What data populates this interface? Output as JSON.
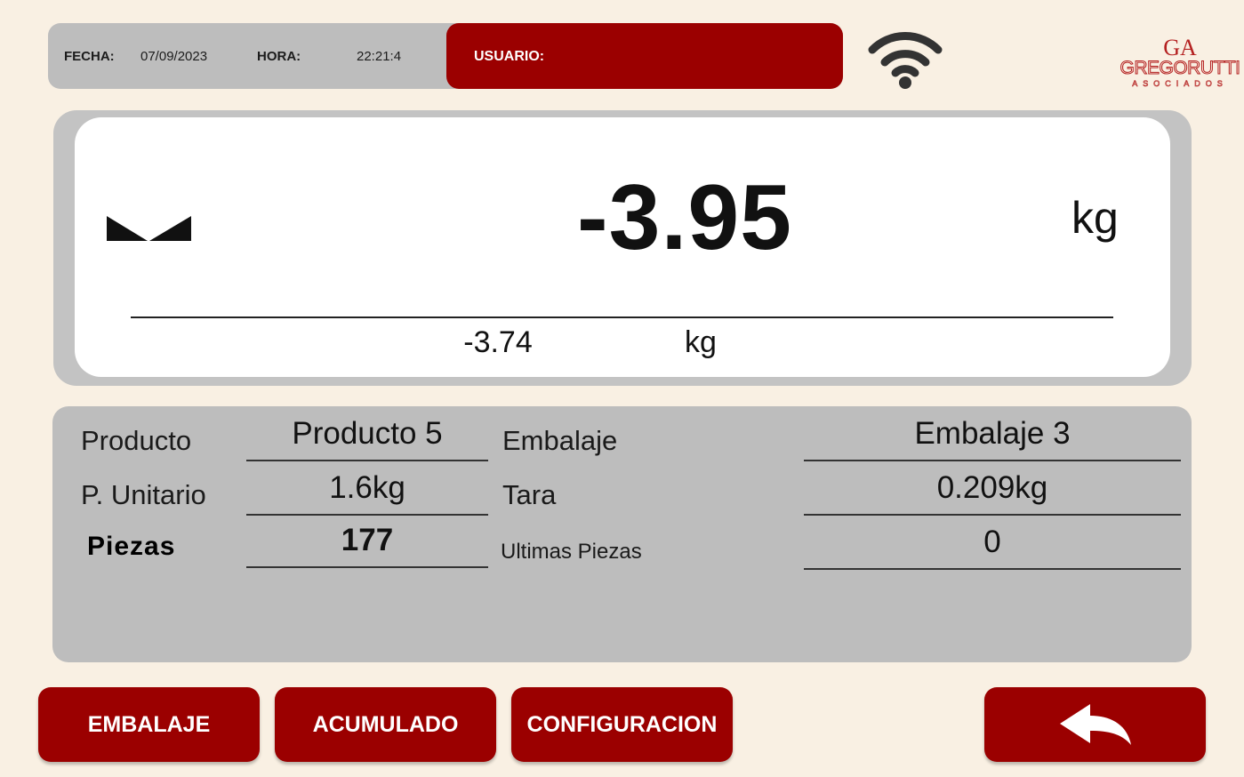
{
  "header": {
    "fecha_label": "FECHA:",
    "fecha_value": "07/09/2023",
    "hora_label": "HORA:",
    "hora_value": "22:21:4",
    "usuario_label": "USUARIO:",
    "usuario_value": ""
  },
  "status": {
    "wifi_icon": "wifi-icon"
  },
  "logo": {
    "name": "GREGORUTTI",
    "sub": "ASOCIADOS",
    "mark": "GA"
  },
  "display": {
    "stability_icon": "unstable-indicator-icon",
    "weight": "-3.95",
    "unit": "kg",
    "secondary_weight": "-3.74",
    "secondary_unit": "kg"
  },
  "info": {
    "producto_label": "Producto",
    "producto_value": "Producto 5",
    "embalaje_label": "Embalaje",
    "embalaje_value": "Embalaje 3",
    "unitario_label": "P. Unitario",
    "unitario_value": "1.6kg",
    "tara_label": "Tara",
    "tara_value": "0.209kg",
    "piezas_label": "Piezas",
    "piezas_value": "177",
    "ultimas_label": "Ultimas Piezas",
    "ultimas_value": "0"
  },
  "buttons": {
    "embalaje": "EMBALAJE",
    "acumulado": "ACUMULADO",
    "configuracion": "CONFIGURACION",
    "back_icon": "back-arrow-icon"
  },
  "colors": {
    "accent": "#9b0000",
    "panel": "#bdbdbd",
    "background": "#f9f0e3"
  }
}
